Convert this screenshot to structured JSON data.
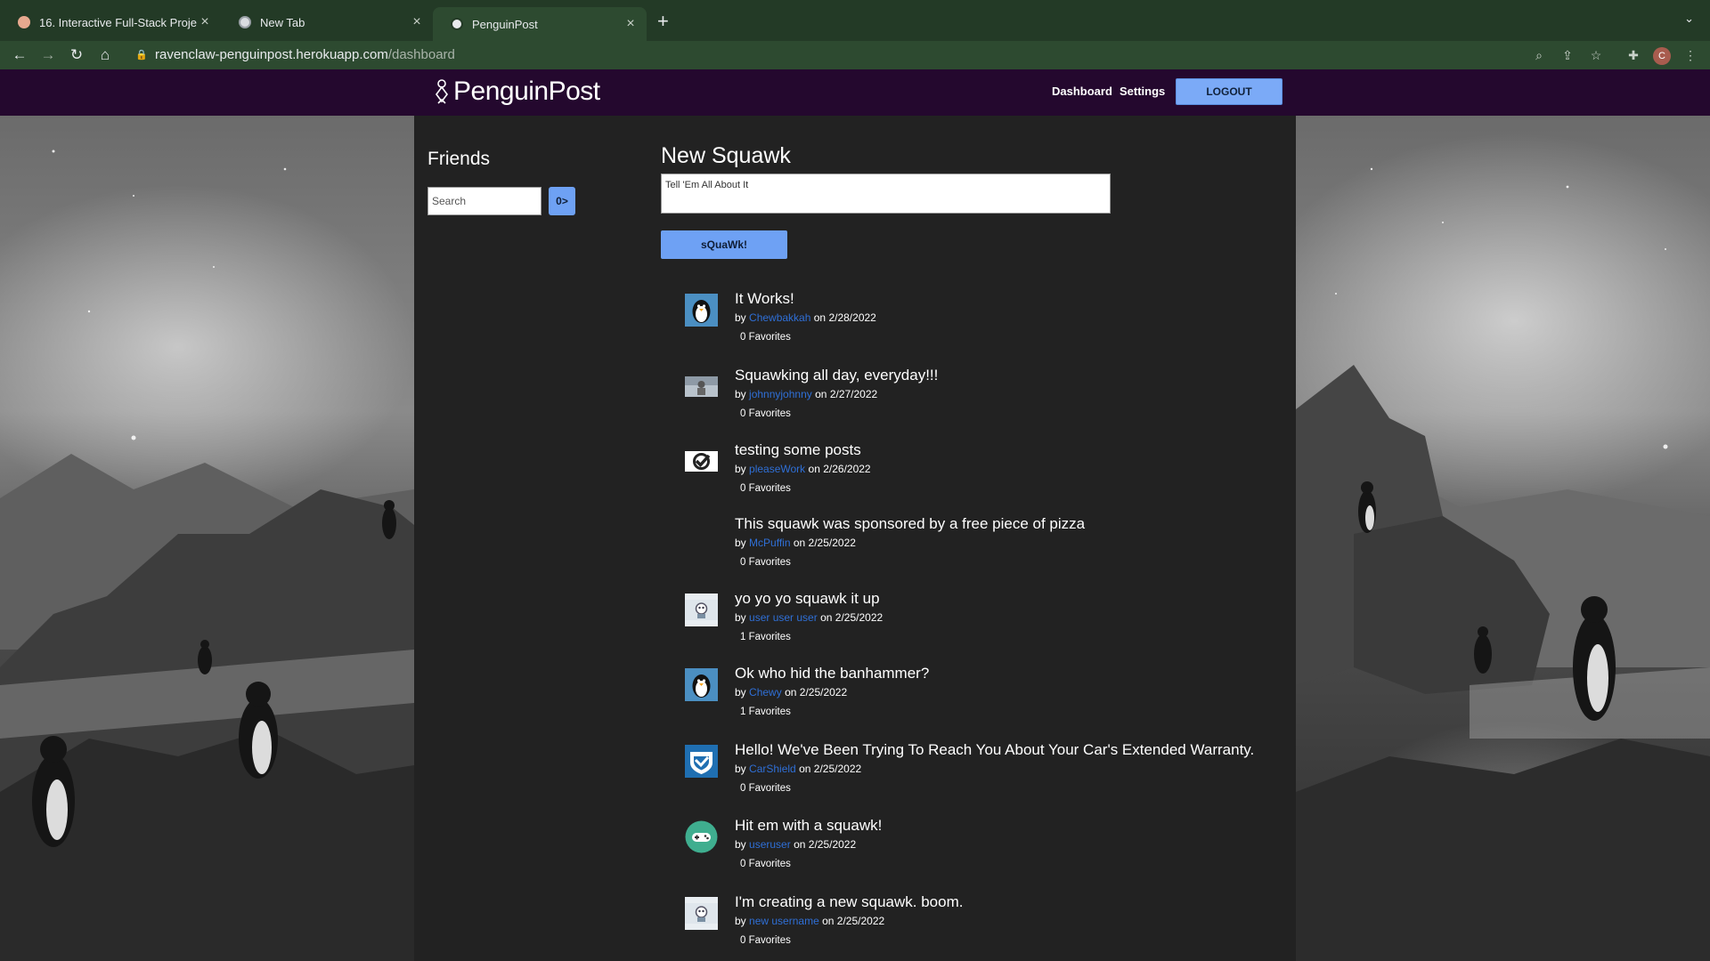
{
  "browser": {
    "tabs": [
      {
        "title": "16. Interactive Full-Stack Proje",
        "active": false
      },
      {
        "title": "New Tab",
        "active": false
      },
      {
        "title": "PenguinPost",
        "active": true
      }
    ],
    "url_host": "ravenclaw-penguinpost.herokuapp.com",
    "url_path": "/dashboard",
    "profile_initial": "C"
  },
  "header": {
    "logo_text": "PenguinPost",
    "nav": {
      "dashboard": "Dashboard",
      "settings": "Settings",
      "logout": "LOGOUT"
    }
  },
  "friends": {
    "title": "Friends",
    "search_placeholder": "Search",
    "search_button": "0>"
  },
  "new_squawk": {
    "title": "New Squawk",
    "placeholder": "Tell 'Em All About It",
    "submit_label": "sQuaWk!"
  },
  "posts": [
    {
      "title": "It Works!",
      "by": "by",
      "author": "Chewbakkah",
      "on": "on",
      "date": "2/28/2022",
      "favorites": "0 Favorites",
      "avatar": "penguin-icon"
    },
    {
      "title": "Squawking all day, everyday!!!",
      "by": "by",
      "author": "johnnyjohnny",
      "on": "on",
      "date": "2/27/2022",
      "favorites": "0 Favorites",
      "avatar": "photo-avatar-icon"
    },
    {
      "title": "testing some posts",
      "by": "by",
      "author": "pleaseWork",
      "on": "on",
      "date": "2/26/2022",
      "favorites": "0 Favorites",
      "avatar": "checkmark-icon"
    },
    {
      "title": "This squawk was sponsored by a free piece of pizza",
      "by": "by",
      "author": "McPuffin",
      "on": "on",
      "date": "2/25/2022",
      "favorites": "0 Favorites",
      "avatar": "none"
    },
    {
      "title": "yo yo yo squawk it up",
      "by": "by",
      "author": "user user user",
      "on": "on",
      "date": "2/25/2022",
      "favorites": "1 Favorites",
      "avatar": "robot-icon"
    },
    {
      "title": "Ok who hid the banhammer?",
      "by": "by",
      "author": "Chewy",
      "on": "on",
      "date": "2/25/2022",
      "favorites": "1 Favorites",
      "avatar": "penguin-icon"
    },
    {
      "title": "Hello! We've Been Trying To Reach You About Your Car's Extended Warranty.",
      "by": "by",
      "author": "CarShield",
      "on": "on",
      "date": "2/25/2022",
      "favorites": "0 Favorites",
      "avatar": "shield-icon"
    },
    {
      "title": "Hit em with a squawk!",
      "by": "by",
      "author": "useruser",
      "on": "on",
      "date": "2/25/2022",
      "favorites": "0 Favorites",
      "avatar": "gamepad-icon"
    },
    {
      "title": "I'm creating a new squawk. boom.",
      "by": "by",
      "author": "new username",
      "on": "on",
      "date": "2/25/2022",
      "favorites": "0 Favorites",
      "avatar": "robot-icon"
    }
  ],
  "colors": {
    "header_bg": "#24082e",
    "content_bg": "#222222",
    "button_blue": "#6ea1f4",
    "author_link": "#2f6fd6"
  }
}
